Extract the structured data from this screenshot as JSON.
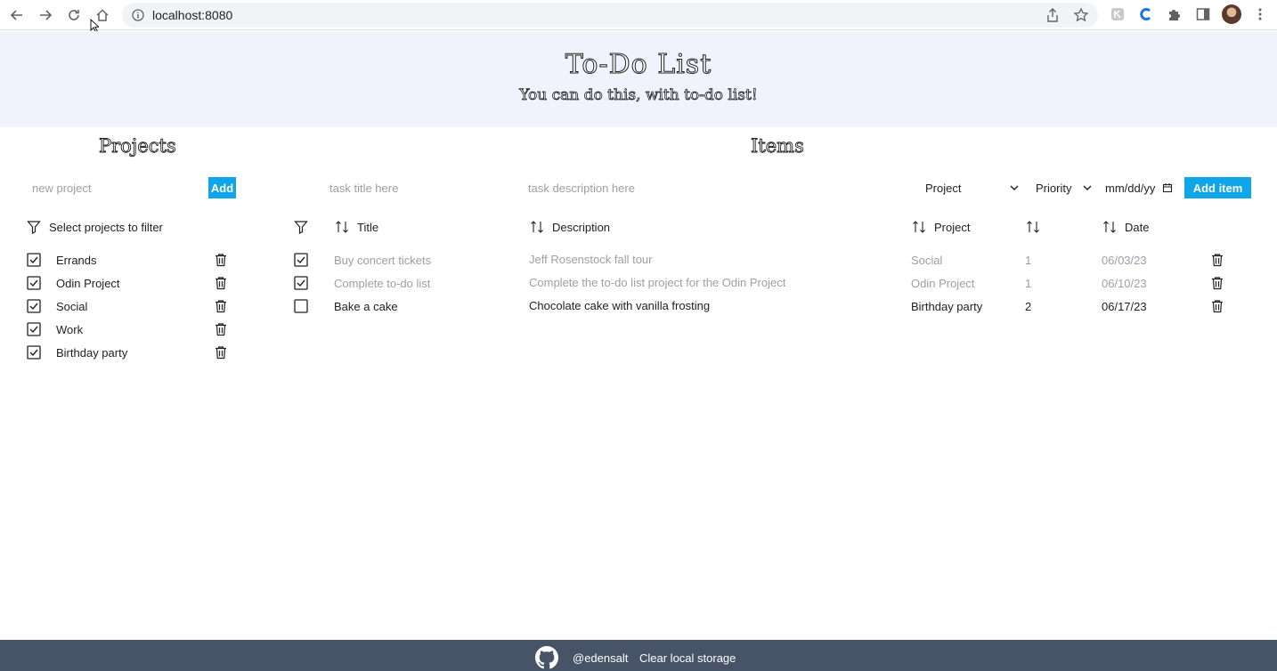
{
  "browser": {
    "url": "localhost:8080"
  },
  "header": {
    "title": "To-Do List",
    "subtitle": "You can do this, with to-do list!"
  },
  "projects_panel": {
    "title": "Projects",
    "new_project_placeholder": "new project",
    "add_label": "Add",
    "filter_label": "Select projects to filter",
    "items": [
      {
        "name": "Errands",
        "checked": true
      },
      {
        "name": "Odin Project",
        "checked": true
      },
      {
        "name": "Social",
        "checked": true
      },
      {
        "name": "Work",
        "checked": true
      },
      {
        "name": "Birthday party",
        "checked": true
      }
    ]
  },
  "items_panel": {
    "title": "Items",
    "task_title_placeholder": "task title here",
    "task_description_placeholder": "task description here",
    "project_select": "Project",
    "priority_select": "Priority",
    "date_placeholder": "mm/dd/yy",
    "add_item_label": "Add item",
    "columns": {
      "title": "Title",
      "description": "Description",
      "project": "Project",
      "date": "Date"
    },
    "rows": [
      {
        "done": true,
        "title": "Buy concert tickets",
        "description": "Jeff Rosenstock fall tour",
        "project": "Social",
        "priority": "1",
        "date": "06/03/23"
      },
      {
        "done": true,
        "title": "Complete to-do list",
        "description": "Complete the to-do list project for the Odin Project",
        "project": "Odin Project",
        "priority": "1",
        "date": "06/10/23"
      },
      {
        "done": false,
        "title": "Bake a cake",
        "description": "Chocolate cake with vanilla frosting",
        "project": "Birthday party",
        "priority": "2",
        "date": "06/17/23"
      }
    ]
  },
  "footer": {
    "handle": "@edensalt",
    "clear_label": "Clear local storage"
  },
  "colors": {
    "accent": "#0ea5e9",
    "header_bg": "#f0f3fb",
    "footer_bg": "#475366",
    "muted_text": "#9aa0a6"
  }
}
